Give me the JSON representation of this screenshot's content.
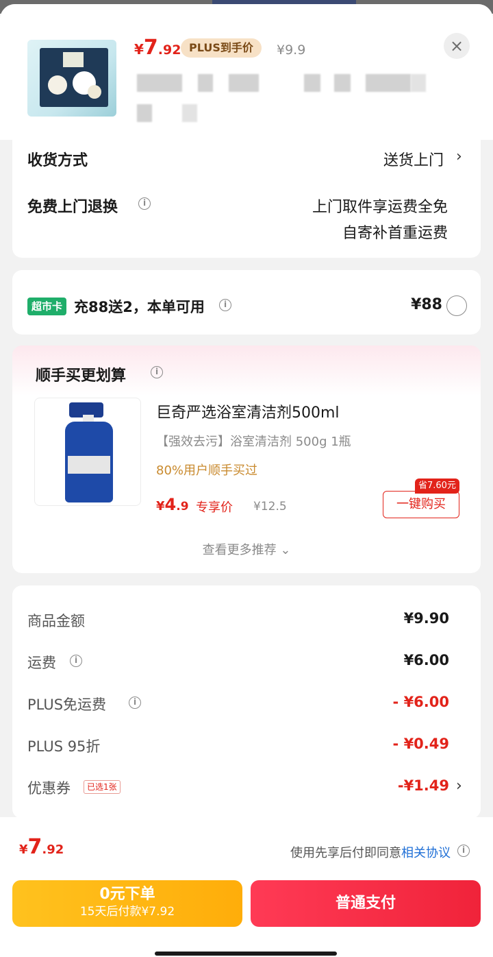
{
  "header": {
    "price_sym": "¥",
    "price_int": "7",
    "price_dec": ".92",
    "plus_tag": "PLUS到手价",
    "original_price": "¥9.9",
    "close": "×"
  },
  "delivery": {
    "method_label": "收货方式",
    "method_value": "送货上门",
    "return_label": "免费上门退换",
    "return_line1": "上门取件享运费全免",
    "return_line2": "自寄补首重运费"
  },
  "market_card": {
    "tag": "超市卡",
    "text": "充88送2，本单可用",
    "price": "¥88"
  },
  "recommend": {
    "title": "顺手买更划算",
    "product": {
      "name": "巨奇严选浴室清洁剂500ml",
      "desc": "【强效去污】浴室清洁剂 500g 1瓶",
      "bought": "80%用户顺手买过",
      "price_sym": "¥",
      "price_int": "4",
      "price_dec": ".9",
      "exclusive": "专享价",
      "original_price": "¥12.5",
      "save_badge": "省7.60元",
      "buy_button": "一键购买"
    },
    "more": "查看更多推荐 ⌄"
  },
  "summary": {
    "rows": [
      {
        "label": "商品金额",
        "value": "¥9.90"
      },
      {
        "label": "运费",
        "value": "¥6.00"
      },
      {
        "label": "PLUS免运费",
        "value": "- ¥6.00"
      },
      {
        "label": "PLUS 95折",
        "value": "- ¥0.49"
      },
      {
        "label": "优惠券",
        "value": "-¥1.49"
      }
    ],
    "coupon_tag": "已选1张"
  },
  "footer": {
    "price_sym": "¥",
    "price_int": "7",
    "price_dec": ".92",
    "agree_text": "使用先享后付即同意",
    "agree_link": "相关协议",
    "zero_line1": "0元下单",
    "zero_line2": "15天后付款¥7.92",
    "pay": "普通支付"
  },
  "colors": {
    "accent_red": "#e2231a",
    "plus_gold": "#f7e1c6",
    "market_green": "#1fae6a",
    "link_blue": "#1f6fd6",
    "zero_button": "#ffb714",
    "pay_button": "#f52d47"
  }
}
